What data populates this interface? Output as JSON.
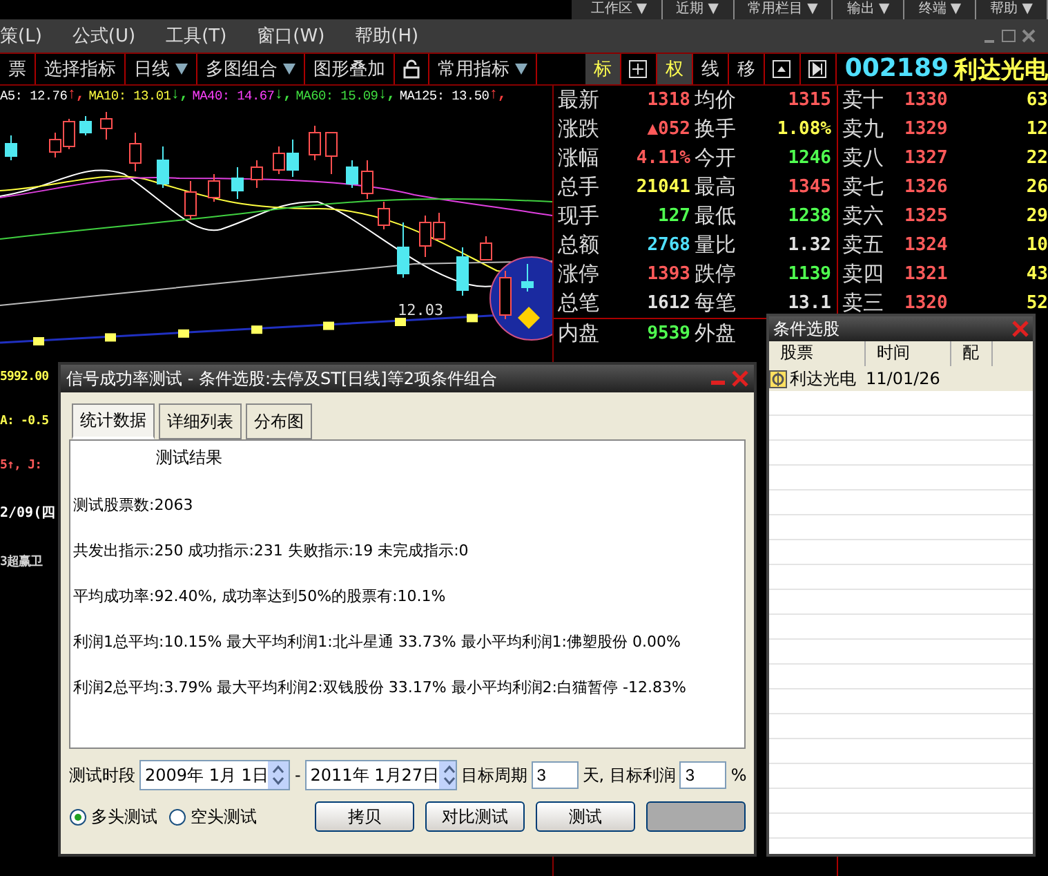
{
  "top_menu": [
    "工作区 ▼",
    "近期 ▼",
    "常用栏目 ▼",
    "输出 ▼",
    "终端 ▼",
    "帮助 ▼"
  ],
  "menu_bar": [
    "策(L)",
    "公式(U)",
    "工具(T)",
    "窗口(W)",
    "帮助(H)"
  ],
  "toolbar": [
    {
      "label": "票",
      "dropdown": false
    },
    {
      "label": "选择指标",
      "dropdown": false
    },
    {
      "label": "日线",
      "dropdown": true
    },
    {
      "label": "多图组合",
      "dropdown": true
    },
    {
      "label": "图形叠加",
      "dropdown": false
    },
    {
      "kind": "lock"
    },
    {
      "label": "常用指标",
      "dropdown": true
    }
  ],
  "view_buttons": [
    {
      "kind": "text",
      "label": "标",
      "selected": true
    },
    {
      "kind": "grid",
      "selected": false
    },
    {
      "kind": "text",
      "label": "权",
      "selected": true
    },
    {
      "kind": "text",
      "label": "线",
      "selected": false
    },
    {
      "kind": "text",
      "label": "移",
      "selected": false
    },
    {
      "kind": "up",
      "selected": false
    },
    {
      "kind": "next",
      "selected": false
    }
  ],
  "stock": {
    "code": "002189",
    "name": "利达光电"
  },
  "ma_legend": [
    {
      "kind": "value",
      "text": "A5: 12.76",
      "color": "#ffffff"
    },
    {
      "kind": "arrow",
      "text": "↑,",
      "color": "#ff4040"
    },
    {
      "kind": "value",
      "text": "MA10: 13.01",
      "color": "#ffff40"
    },
    {
      "kind": "arrow",
      "text": "↓,",
      "color": "#40e040"
    },
    {
      "kind": "value",
      "text": "MA40: 14.67",
      "color": "#ff40ff"
    },
    {
      "kind": "arrow",
      "text": "↓,",
      "color": "#40e040"
    },
    {
      "kind": "value",
      "text": "MA60: 15.09",
      "color": "#40e040"
    },
    {
      "kind": "arrow",
      "text": "↓,",
      "color": "#40e040"
    },
    {
      "kind": "value",
      "text": "MA125: 13.50",
      "color": "#ffffff"
    },
    {
      "kind": "arrow",
      "text": "↑,",
      "color": "#ff4040"
    }
  ],
  "chart": {
    "price_label": "12.03"
  },
  "quote": [
    {
      "cells": [
        {
          "label": "最新",
          "value": "1318",
          "color": "#ff5a5a"
        },
        {
          "label": "均价",
          "value": "1315",
          "color": "#ff5a5a"
        }
      ]
    },
    {
      "cells": [
        {
          "label": "涨跌",
          "value": "▲052",
          "color": "#ff5a5a"
        },
        {
          "label": "换手",
          "value": "1.08%",
          "color": "#ffff50"
        }
      ]
    },
    {
      "cells": [
        {
          "label": "涨幅",
          "value": "4.11%",
          "color": "#ff5a5a"
        },
        {
          "label": "今开",
          "value": "1246",
          "color": "#50ff50"
        }
      ]
    },
    {
      "cells": [
        {
          "label": "总手",
          "value": "21041",
          "color": "#ffff50"
        },
        {
          "label": "最高",
          "value": "1345",
          "color": "#ff5a5a"
        }
      ]
    },
    {
      "cells": [
        {
          "label": "现手",
          "value": "127",
          "color": "#50ff50"
        },
        {
          "label": "最低",
          "value": "1238",
          "color": "#50ff50"
        }
      ]
    },
    {
      "cells": [
        {
          "label": "总额",
          "value": "2768",
          "color": "#50e0ff"
        },
        {
          "label": "量比",
          "value": "1.32",
          "color": "#e0e0e0"
        }
      ]
    },
    {
      "cells": [
        {
          "label": "涨停",
          "value": "1393",
          "color": "#ff5a5a"
        },
        {
          "label": "跌停",
          "value": "1139",
          "color": "#50ff50"
        }
      ]
    },
    {
      "cells": [
        {
          "label": "总笔",
          "value": "1612",
          "color": "#e0e0e0"
        },
        {
          "label": "每笔",
          "value": "13.1",
          "color": "#e0e0e0"
        }
      ]
    },
    {
      "cells": [
        {
          "label": "内盘",
          "value": "9539",
          "color": "#50ff50"
        },
        {
          "label": "外盘"
        }
      ]
    }
  ],
  "sell": [
    {
      "label": "卖十",
      "price": "1330",
      "volume": "63"
    },
    {
      "label": "卖九",
      "price": "1329",
      "volume": "12"
    },
    {
      "label": "卖八",
      "price": "1327",
      "volume": "22"
    },
    {
      "label": "卖七",
      "price": "1326",
      "volume": "26"
    },
    {
      "label": "卖六",
      "price": "1325",
      "volume": "29"
    },
    {
      "label": "卖五",
      "price": "1324",
      "volume": "10"
    },
    {
      "label": "卖四",
      "price": "1321",
      "volume": "43"
    },
    {
      "label": "卖三",
      "price": "1320",
      "volume": "52"
    }
  ],
  "side_fragments": [
    {
      "text": "5992.00",
      "color": "#ffff50"
    },
    {
      "text": "A: -0.5",
      "color": "#ffff50"
    },
    {
      "text": "5↑, J:",
      "color": "#ff5a5a"
    },
    {
      "text": "2/09(四",
      "color": "#ffffff"
    },
    {
      "text": "3超赢卫",
      "color": "#d0d0d0"
    }
  ],
  "dialog": {
    "title": "信号成功率测试 - 条件选股:去停及ST[日线]等2项条件组合",
    "tabs": [
      {
        "label": "统计数据",
        "selected": true
      },
      {
        "label": "详细列表",
        "selected": false
      },
      {
        "label": "分布图",
        "selected": false
      }
    ],
    "heading": "测试结果",
    "lines": [
      "测试股票数:2063",
      "共发出指示:250 成功指示:231 失败指示:19 未完成指示:0",
      "平均成功率:92.40%, 成功率达到50%的股票有:10.1%",
      "利润1总平均:10.15% 最大平均利润1:北斗星通 33.73% 最小平均利润1:佛塑股份 0.00%",
      "利润2总平均:3.79% 最大平均利润2:双钱股份 33.17% 最小平均利润2:白猫暂停 -12.83%"
    ],
    "period_label": "测试时段",
    "start_date": "2009年 1月 1日",
    "dash": "-",
    "end_date": "2011年 1月27日",
    "cycle_label": "目标周期",
    "cycle": "3",
    "profit_label": "天, 目标利润",
    "profit": "3",
    "percent": "%",
    "modes": [
      {
        "label": "多头测试",
        "selected": true
      },
      {
        "label": "空头测试",
        "selected": false
      }
    ],
    "buttons": [
      "拷贝",
      "对比测试",
      "测试"
    ],
    "blank_button": true
  },
  "picker": {
    "title": "条件选股",
    "columns": [
      "股票",
      "时间",
      "配"
    ],
    "rows": [
      {
        "stock": "利达光电",
        "time": "11/01/26"
      }
    ]
  }
}
